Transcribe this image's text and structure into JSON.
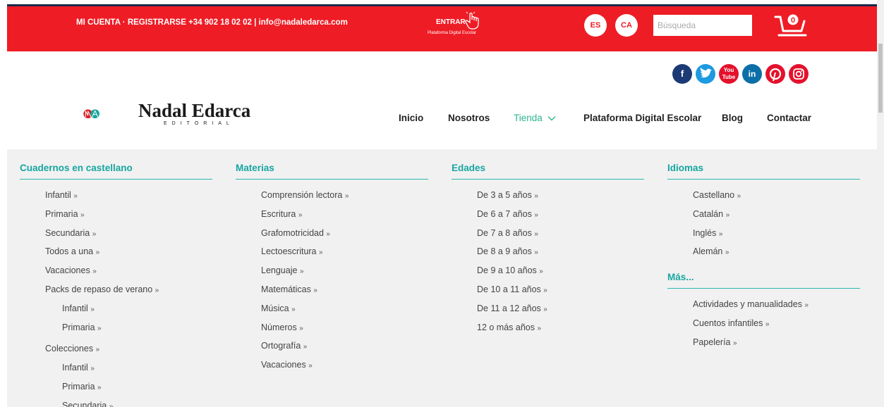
{
  "topbar": {
    "account_text": "MI CUENTA · REGISTRARSE +34 902 18 02 02 | info@nadaledarca.com",
    "entrar_label": "ENTRAR",
    "entrar_sub": "Plataforma Digital Escolar",
    "lang_es": "ES",
    "lang_ca": "CA",
    "search_placeholder": "Búsqueda",
    "cart_count": "0",
    "bar_color": "#ee1c25"
  },
  "social": {
    "facebook": "f",
    "twitter": "t",
    "youtube": "You Tube",
    "linkedin": "in",
    "pinterest": "p",
    "instagram": "ig"
  },
  "brand": {
    "name": "Nadal Edarca",
    "tagline": "EDITORIAL"
  },
  "nav": {
    "inicio": "Inicio",
    "nosotros": "Nosotros",
    "tienda": "Tienda",
    "plataforma": "Plataforma Digital Escolar",
    "blog": "Blog",
    "contactar": "Contactar"
  },
  "menu": {
    "col1": {
      "title": "Cuadernos en castellano",
      "items": [
        "Infantil",
        "Primaria",
        "Secundaria",
        "Todos a una",
        "Vacaciones",
        "Packs de repaso de verano",
        "Infantil",
        "Primaria",
        "Colecciones",
        "Infantil",
        "Primaria",
        "Secundaria"
      ]
    },
    "col2": {
      "title": "Materias",
      "items": [
        "Comprensión lectora",
        "Escritura",
        "Grafomotricidad",
        "Lectoescritura",
        "Lenguaje",
        "Matemáticas",
        "Música",
        "Números",
        "Ortografía",
        "Vacaciones"
      ]
    },
    "col3": {
      "title": "Edades",
      "items": [
        "De 3 a 5 años",
        "De 6 a 7 años",
        "De 7 a 8 años",
        "De 8 a 9 años",
        "De 9 a 10 años",
        "De 10 a 11 años",
        "De 11 a 12 años",
        "12 o más años"
      ]
    },
    "col4": {
      "title": "Idiomas",
      "items": [
        "Castellano",
        "Catalán",
        "Inglés",
        "Alemán"
      ]
    },
    "col5": {
      "title": "Más...",
      "items": [
        "Actividades y manualidades",
        "Cuentos infantiles",
        "Papelería"
      ]
    },
    "arrow": "»"
  },
  "colors": {
    "accent": "#17a6a0",
    "red": "#ee1c25",
    "menu_bg": "#f1f1f1"
  }
}
